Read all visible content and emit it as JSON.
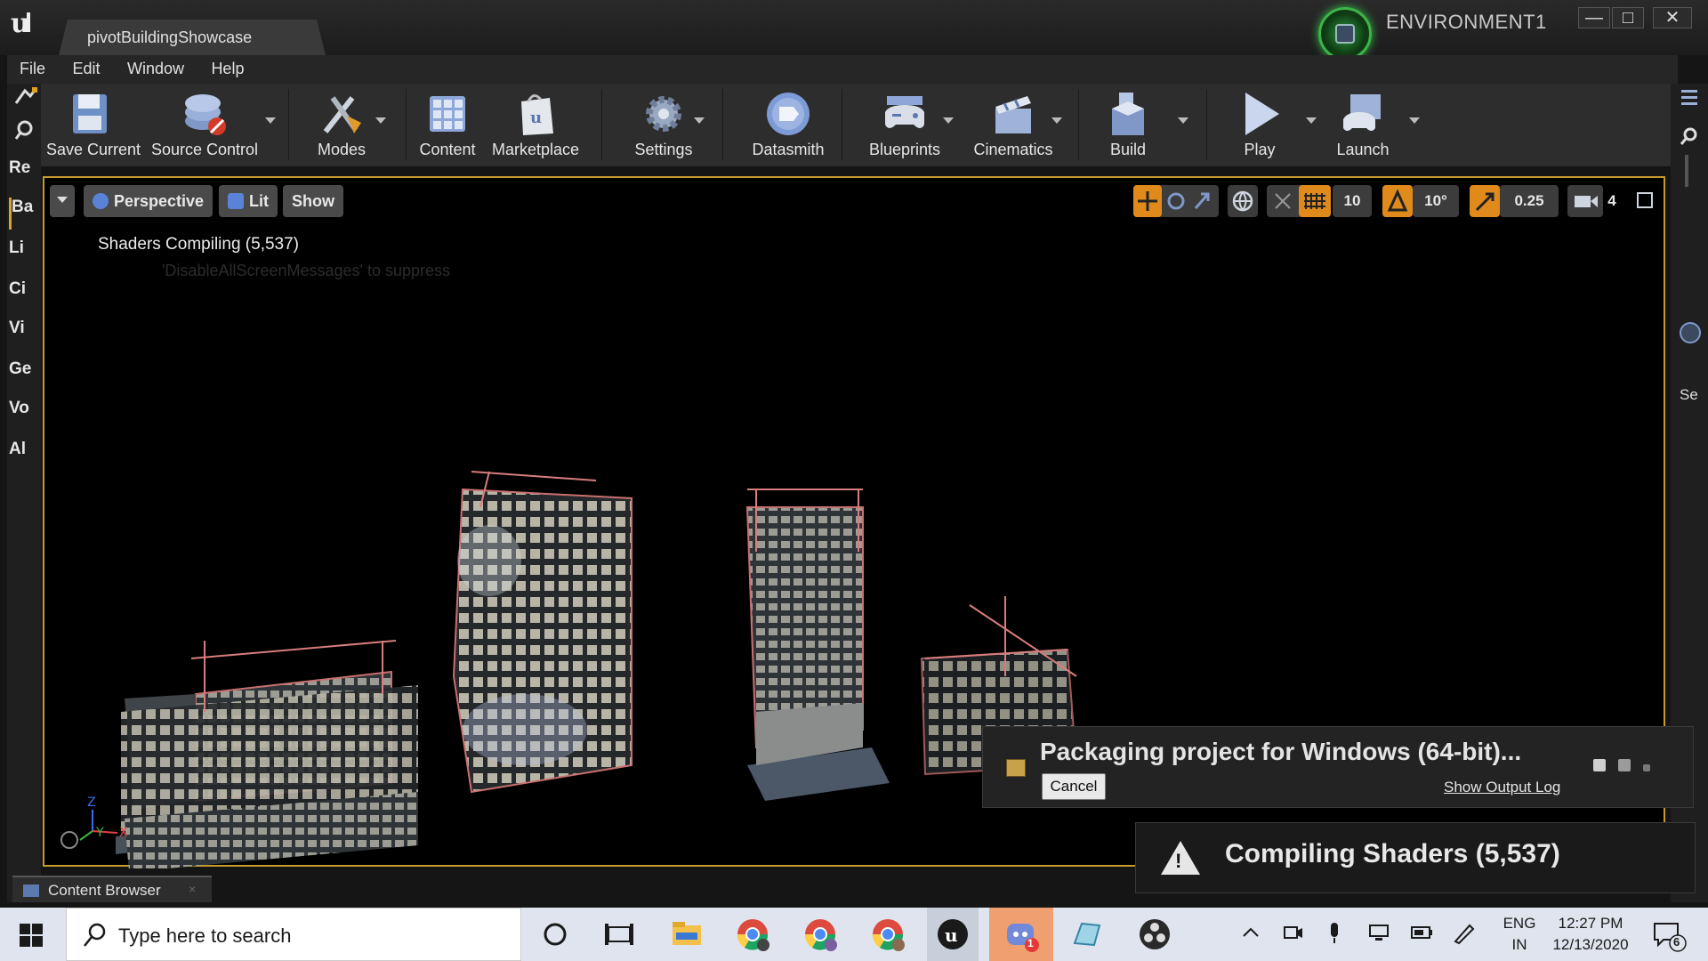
{
  "window": {
    "doc_tab": "pivotBuildingShowcase",
    "environment_name": "ENVIRONMENT1",
    "min_glyph": "—",
    "max_glyph": "□",
    "close_glyph": "✕"
  },
  "menu": [
    "File",
    "Edit",
    "Window",
    "Help"
  ],
  "left_tabs": [
    "Re",
    "Ba",
    "Li",
    "Ci",
    "Vi",
    "Ge",
    "Vo",
    "Al"
  ],
  "toolbar": {
    "save_current": "Save Current",
    "source_control": "Source Control",
    "modes": "Modes",
    "content": "Content",
    "marketplace": "Marketplace",
    "settings": "Settings",
    "datasmith": "Datasmith",
    "blueprints": "Blueprints",
    "cinematics": "Cinematics",
    "build": "Build",
    "play": "Play",
    "launch": "Launch"
  },
  "viewport": {
    "perspective": "Perspective",
    "lit": "Lit",
    "show": "Show",
    "grid_snap": "10",
    "rotation_snap": "10°",
    "scale_snap": "0.25",
    "camera_speed": "4",
    "shaders_message": "Shaders Compiling (5,537)",
    "suppress_message": "'DisableAllScreenMessages' to suppress"
  },
  "notifications": {
    "packaging_title": "Packaging project for Windows (64-bit)...",
    "cancel": "Cancel",
    "show_output_log": "Show Output Log",
    "compiling_title": "Compiling Shaders (5,537)"
  },
  "content_browser": {
    "label": "Content Browser",
    "close": "×"
  },
  "right_strip": {
    "label": "Se"
  },
  "taskbar": {
    "search_placeholder": "Type here to search",
    "language_top": "ENG",
    "language_bottom": "IN",
    "time": "12:27 PM",
    "date": "12/13/2020",
    "notif_count": "6",
    "discord_badge": "1"
  },
  "colors": {
    "viewport_border": "#c79a2c",
    "snap_orange": "#e08a1c",
    "env_green": "#3bb54a"
  }
}
